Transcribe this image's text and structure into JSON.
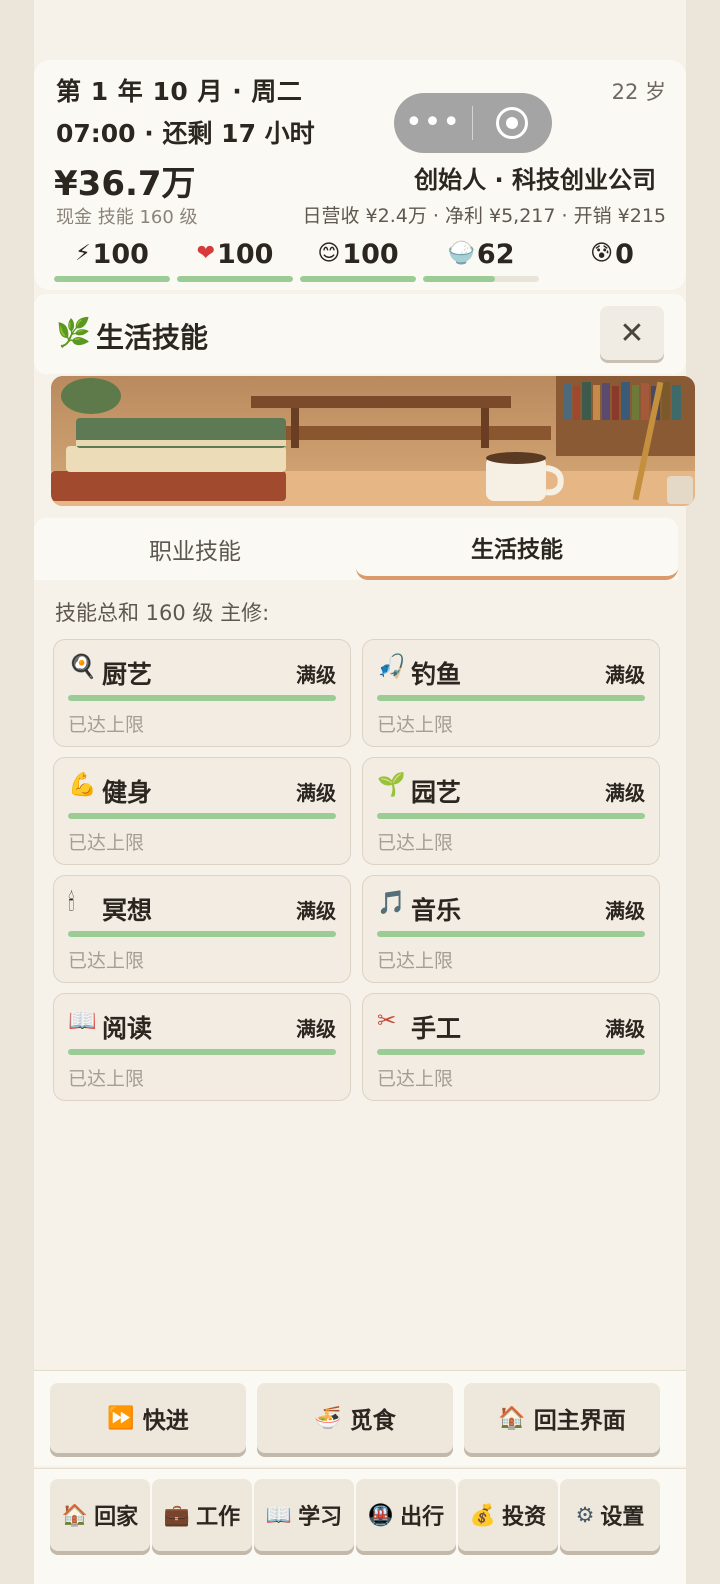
{
  "header": {
    "date": "第 1 年 10 月 · 周二",
    "time": "07:00 · 还剩 17 小时",
    "age": "22 岁",
    "cash": "¥36.7万",
    "role": "创始人 · 科技创业公司",
    "sub_left": "现金  技能 160 级",
    "sub_right": "日营收 ¥2.4万 · 净利 ¥5,217 · 开销 ¥215",
    "stats": [
      {
        "icon": "⚡",
        "icon_name": "energy-icon",
        "value": "100",
        "fill": 1.0
      },
      {
        "icon": "❤",
        "icon_name": "health-icon",
        "value": "100",
        "fill": 1.0
      },
      {
        "icon": "😊",
        "icon_name": "mood-icon",
        "value": "100",
        "fill": 1.0
      },
      {
        "icon": "🍚",
        "icon_name": "hunger-icon",
        "value": "62",
        "fill": 0.62
      },
      {
        "icon": "😰",
        "icon_name": "stress-icon",
        "value": "0",
        "fill": 0
      }
    ]
  },
  "panel": {
    "icon": "🌿",
    "title": "生活技能",
    "close_label": "✕"
  },
  "tabs": [
    {
      "label": "职业技能"
    },
    {
      "label": "生活技能"
    }
  ],
  "summary": "技能总和 160 级   主修:",
  "skills": [
    {
      "icon": "🍳",
      "name": "厨艺",
      "level": "满级",
      "note": "已达上限",
      "progress": 1.0
    },
    {
      "icon": "🎣",
      "name": "钓鱼",
      "level": "满级",
      "note": "已达上限",
      "progress": 1.0
    },
    {
      "icon": "💪",
      "name": "健身",
      "level": "满级",
      "note": "已达上限",
      "progress": 1.0
    },
    {
      "icon": "🌱",
      "name": "园艺",
      "level": "满级",
      "note": "已达上限",
      "progress": 1.0
    },
    {
      "icon": "🕯",
      "name": "冥想",
      "level": "满级",
      "note": "已达上限",
      "progress": 1.0
    },
    {
      "icon": "🎵",
      "name": "音乐",
      "level": "满级",
      "note": "已达上限",
      "progress": 1.0
    },
    {
      "icon": "📖",
      "name": "阅读",
      "level": "满级",
      "note": "已达上限",
      "progress": 1.0
    },
    {
      "icon": "✂",
      "name": "手工",
      "level": "满级",
      "note": "已达上限",
      "progress": 1.0
    }
  ],
  "actions": [
    {
      "icon": "⏩",
      "label": "快进"
    },
    {
      "icon": "🍜",
      "label": "觅食"
    },
    {
      "icon": "🏠",
      "label": "回主界面"
    }
  ],
  "nav": [
    {
      "icon": "🏠",
      "label": "回家"
    },
    {
      "icon": "💼",
      "label": "工作"
    },
    {
      "icon": "📖",
      "label": "学习"
    },
    {
      "icon": "🚇",
      "label": "出行"
    },
    {
      "icon": "💰",
      "label": "投资"
    },
    {
      "icon": "⚙",
      "label": "设置"
    }
  ],
  "colors": {
    "background": "#f6f2ea",
    "card": "#f2ece2",
    "progress": "#9ccc95",
    "tab_underline": "#d99a6c"
  }
}
